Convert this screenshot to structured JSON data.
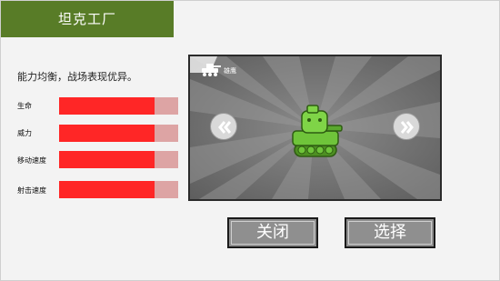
{
  "header": {
    "title": "坦克工厂"
  },
  "tank": {
    "description": "能力均衡，战场表现优异。",
    "name": "雄鹰"
  },
  "stats": [
    {
      "label": "生命",
      "value_fraction": 0.8
    },
    {
      "label": "威力",
      "value_fraction": 0.8
    },
    {
      "label": "移动速度",
      "value_fraction": 0.8
    },
    {
      "label": "射击速度",
      "value_fraction": 0.8
    }
  ],
  "buttons": {
    "close": "关闭",
    "select": "选择"
  },
  "colors": {
    "title_bar": "#587c27",
    "stat_fill": "#ff2626",
    "stat_track": "#dda4a4",
    "tank_body": "#6fc43a"
  },
  "icons": {
    "prev": "double-chevron-left-icon",
    "next": "double-chevron-right-icon",
    "tank_badge": "tank-silhouette-icon"
  }
}
